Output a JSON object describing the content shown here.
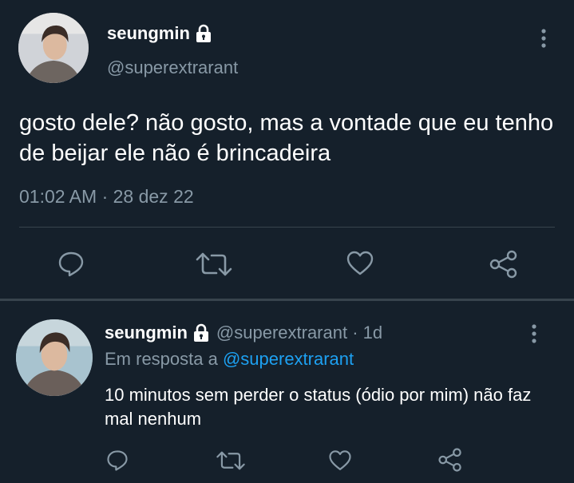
{
  "main_tweet": {
    "author": {
      "display_name": "seungmin",
      "handle": "@superextrarant",
      "protected": true
    },
    "text": "gosto dele? não gosto, mas a vontade que eu tenho de beijar ele não é brincadeira",
    "timestamp": "01:02 AM · 28 dez 22",
    "actions": [
      "reply-icon",
      "retweet-icon",
      "like-icon",
      "share-icon"
    ]
  },
  "reply_tweet": {
    "author": {
      "display_name": "seungmin",
      "handle_time": "@superextrarant · 1d",
      "protected": true
    },
    "replying_prefix": "Em resposta a ",
    "replying_mention": "@superextrarant",
    "text": "10 minutos sem perder o status (ódio por mim) não faz mal nenhum",
    "actions": [
      "reply-icon",
      "retweet-icon",
      "like-icon",
      "share-icon"
    ]
  },
  "colors": {
    "background": "#15202b",
    "text_primary": "#ffffff",
    "text_secondary": "#8899a6",
    "link": "#1da1f2",
    "divider": "#38444d"
  }
}
